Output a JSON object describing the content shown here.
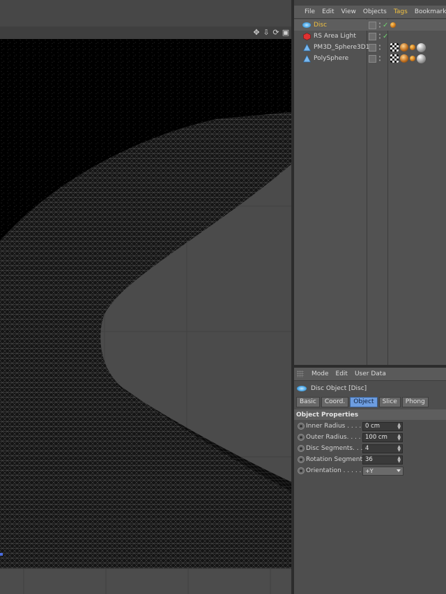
{
  "objects_panel": {
    "menu": [
      "File",
      "Edit",
      "View",
      "Objects",
      "Tags",
      "Bookmarks"
    ],
    "active_menu": "Tags",
    "objects": [
      {
        "name": "Disc",
        "icon": "disc-icon",
        "highlight": true,
        "check": true,
        "tags": [
          "phong"
        ]
      },
      {
        "name": "RS Area Light",
        "icon": "area-light-icon",
        "highlight": false,
        "check": true,
        "tags": []
      },
      {
        "name": "PM3D_Sphere3D1",
        "icon": "polygon-object-icon",
        "highlight": false,
        "check": false,
        "tags": [
          "checker",
          "mat",
          "phong",
          "sphere"
        ]
      },
      {
        "name": "PolySphere",
        "icon": "polygon-object-icon",
        "highlight": false,
        "check": false,
        "tags": [
          "checker",
          "mat",
          "phong",
          "sphere"
        ]
      }
    ]
  },
  "attributes_panel": {
    "menu": [
      "Mode",
      "Edit",
      "User Data"
    ],
    "title": "Disc Object [Disc]",
    "tabs": [
      "Basic",
      "Coord.",
      "Object",
      "Slice",
      "Phong"
    ],
    "active_tab": "Object",
    "section": "Object Properties",
    "params": [
      {
        "label": "Inner Radius . . . . .",
        "value": "0 cm",
        "type": "number"
      },
      {
        "label": "Outer Radius. . . . .",
        "value": "100 cm",
        "type": "number"
      },
      {
        "label": "Disc Segments. . . .",
        "value": "4",
        "type": "number"
      },
      {
        "label": "Rotation Segments",
        "value": "36",
        "type": "number"
      },
      {
        "label": "Orientation . . . . . .",
        "value": "+Y",
        "type": "dropdown"
      }
    ]
  },
  "viewport": {
    "nav_icons": [
      "move-view-icon",
      "dolly-view-icon",
      "rotate-view-icon",
      "maximize-view-icon"
    ]
  },
  "colors": {
    "accent_yellow": "#f0c040",
    "active_tab": "#6d9de0",
    "viewport_bg": "#4a4a4a",
    "mesh_dark": "#161616"
  }
}
